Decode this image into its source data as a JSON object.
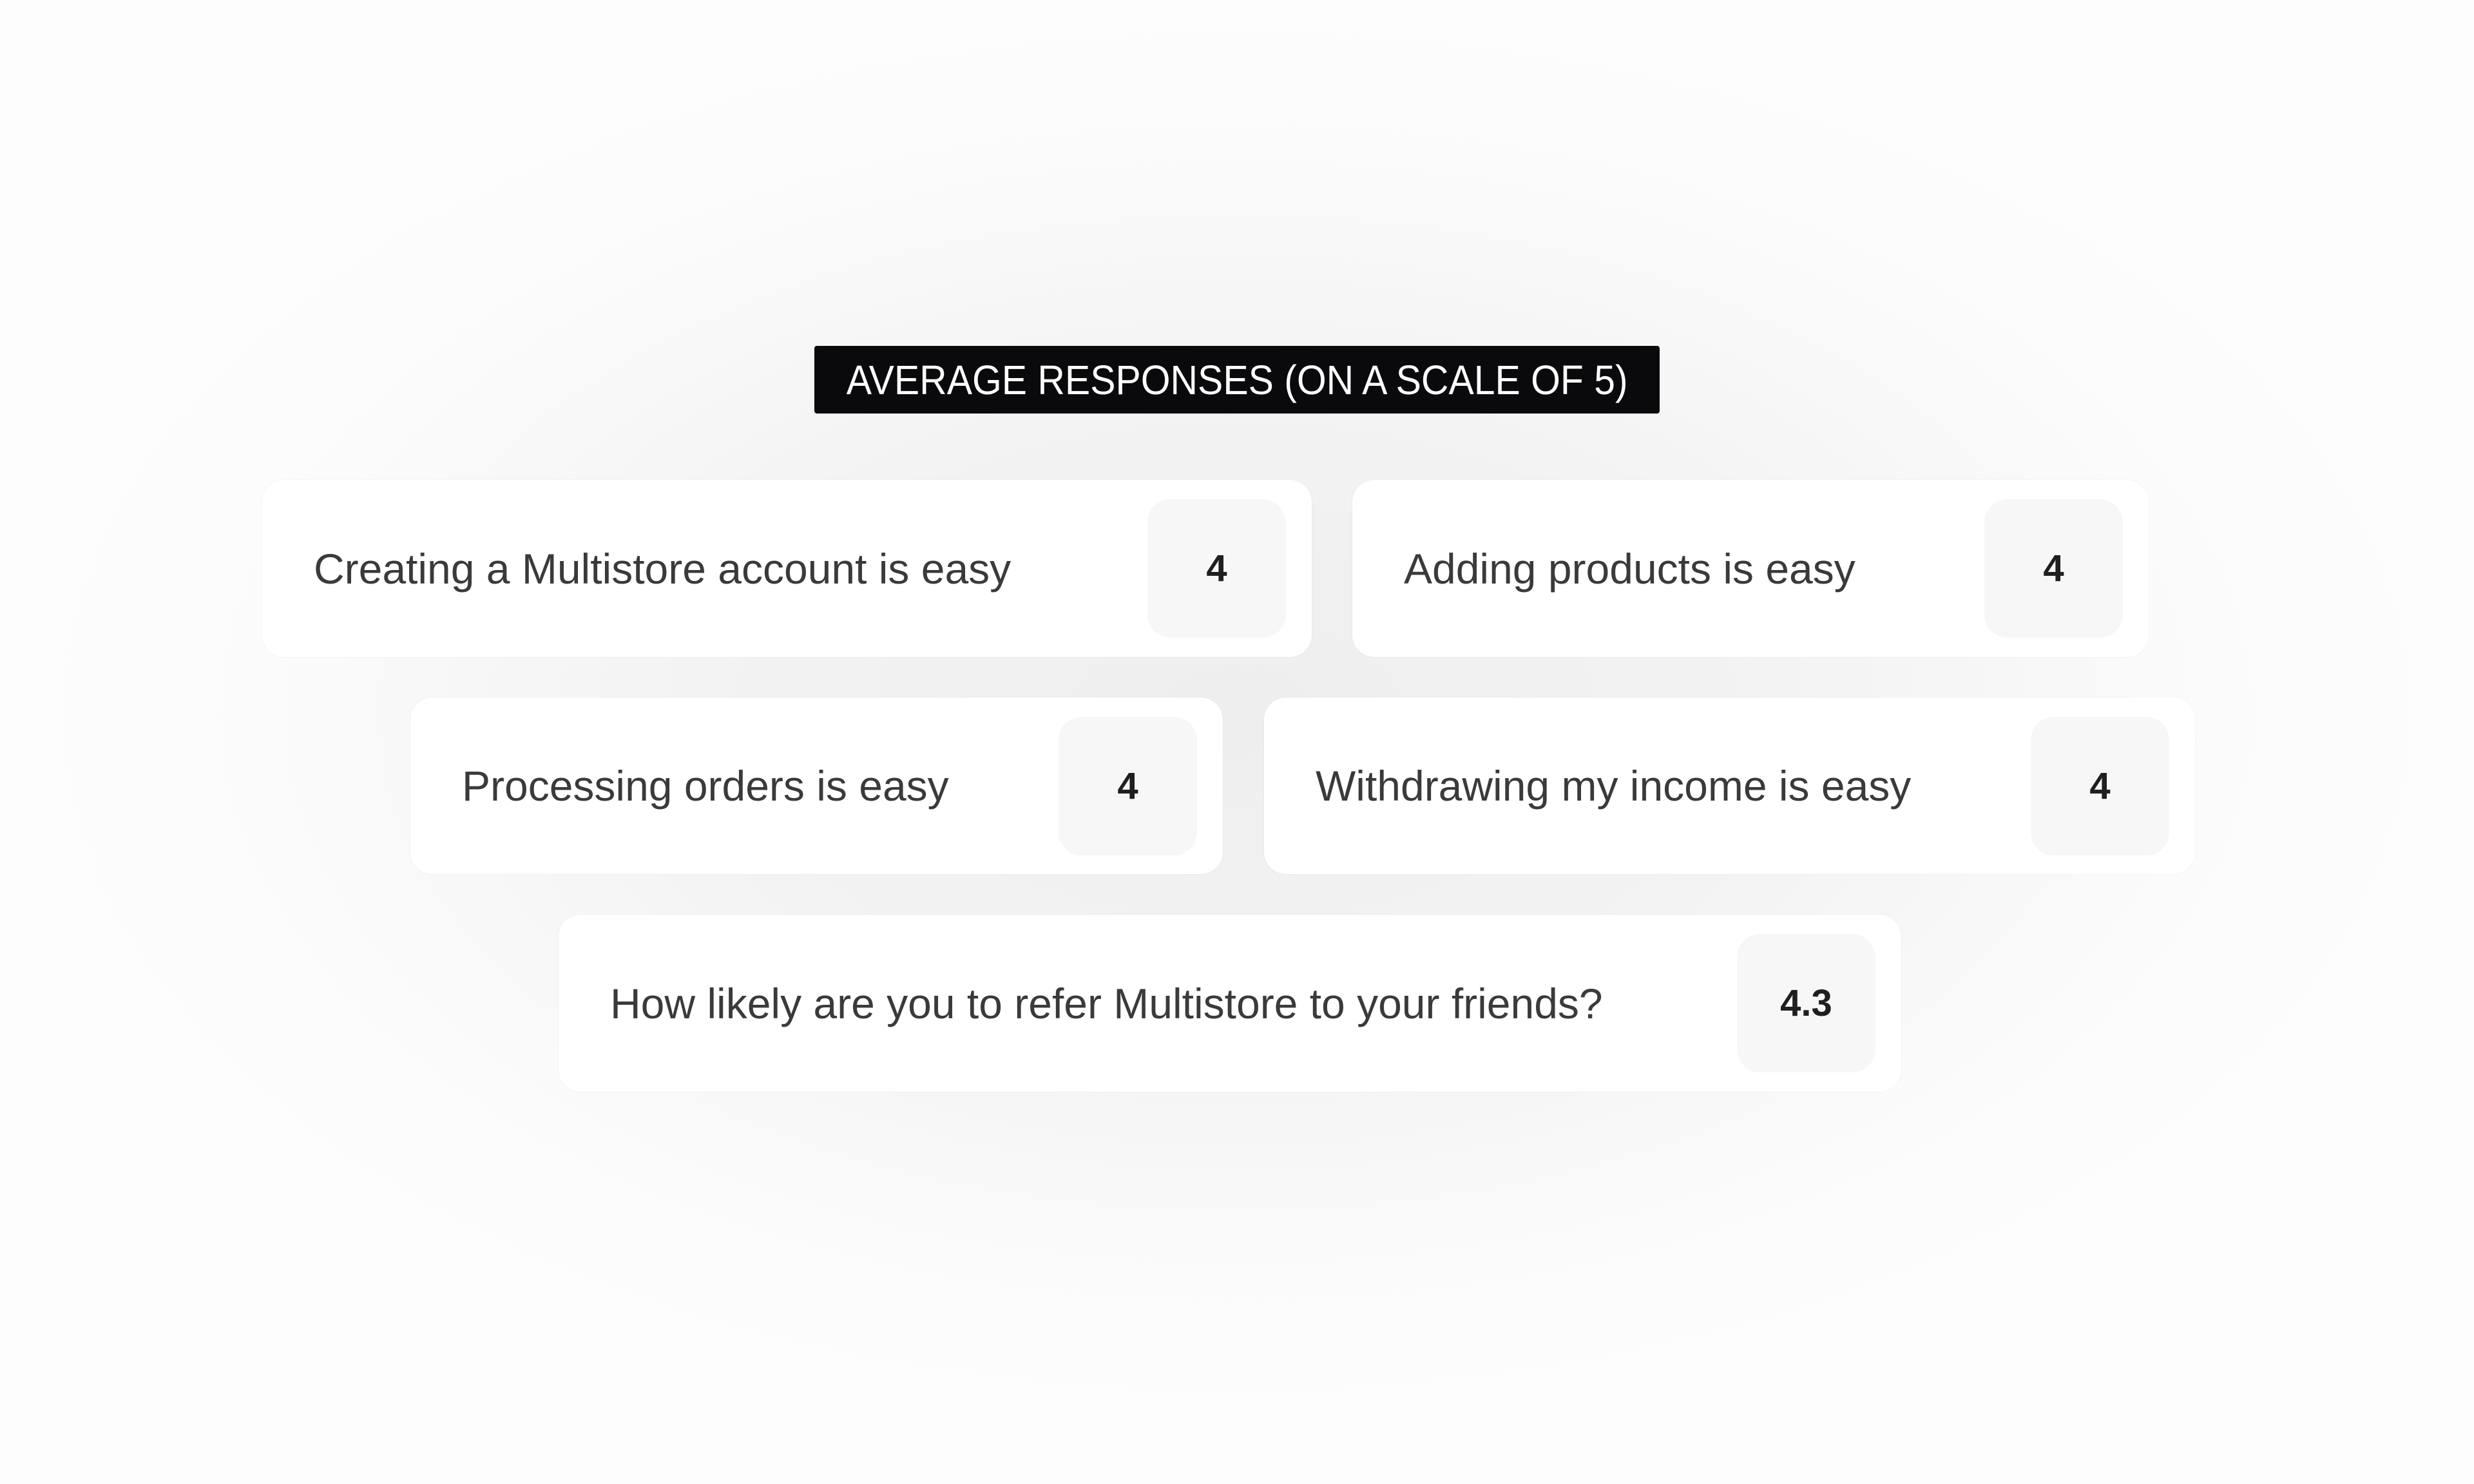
{
  "title": "AVERAGE RESPONSES (ON A SCALE OF 5)",
  "responses": [
    {
      "question": "Creating a Multistore account is easy",
      "value": "4"
    },
    {
      "question": "Adding products is easy",
      "value": "4"
    },
    {
      "question": "Processing orders is easy",
      "value": "4"
    },
    {
      "question": "Withdrawing my income is easy",
      "value": "4"
    },
    {
      "question": "How likely are you to refer Multistore to your friends?",
      "value": "4.3"
    }
  ],
  "colors": {
    "title_bg": "#0a0a0c",
    "title_text": "#ffffff",
    "card_bg": "#ffffff",
    "value_bg": "#f7f7f7",
    "text": "#3a3a3a"
  }
}
